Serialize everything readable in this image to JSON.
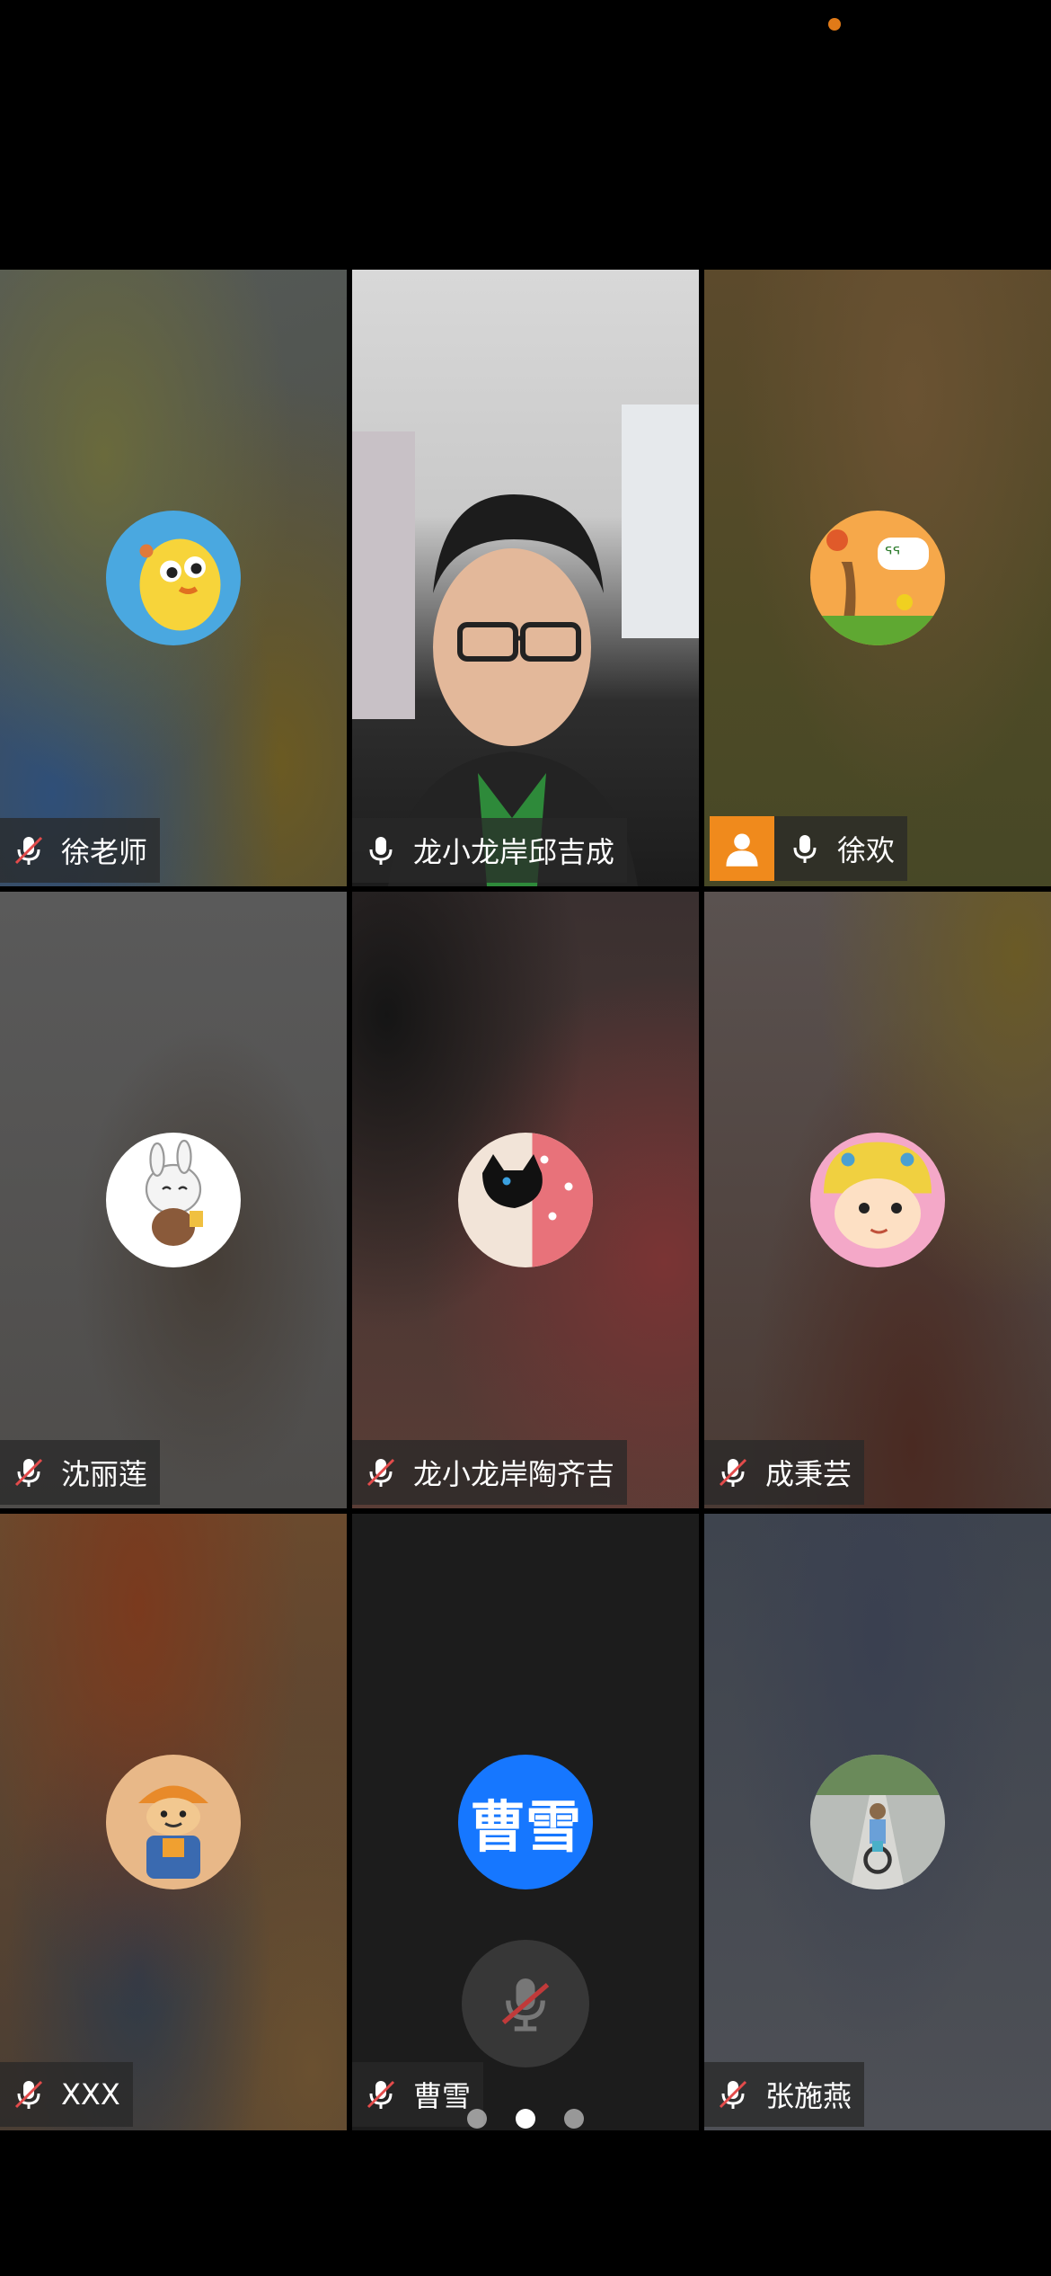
{
  "participants": [
    {
      "name": "徐老师",
      "mic": "muted",
      "avatar": "yellow-bird-avatar"
    },
    {
      "name": "龙小龙岸邱吉成",
      "mic": "on",
      "avatar": "live-video"
    },
    {
      "name": "徐欢",
      "mic": "on",
      "avatar": "kids-drawing-avatar",
      "active": true,
      "badge": "user-icon"
    },
    {
      "name": "沈丽莲",
      "mic": "muted",
      "avatar": "white-rabbit-avatar"
    },
    {
      "name": "龙小龙岸陶齐吉",
      "mic": "muted",
      "avatar": "black-cat-avatar"
    },
    {
      "name": "成秉芸",
      "mic": "muted",
      "avatar": "cartoon-girl-avatar"
    },
    {
      "name": "XXX",
      "mic": "muted",
      "avatar": "cartoon-worker-avatar"
    },
    {
      "name": "曹雪",
      "mic": "muted",
      "avatar_text": "曹雪"
    },
    {
      "name": "张施燕",
      "mic": "muted",
      "avatar": "child-bike-photo-avatar"
    }
  ],
  "pager": {
    "pages": 3,
    "current": 2
  },
  "colors": {
    "active_border": "#22c55e",
    "text_avatar_bg": "#1677ff",
    "badge": "#f08a1c"
  }
}
